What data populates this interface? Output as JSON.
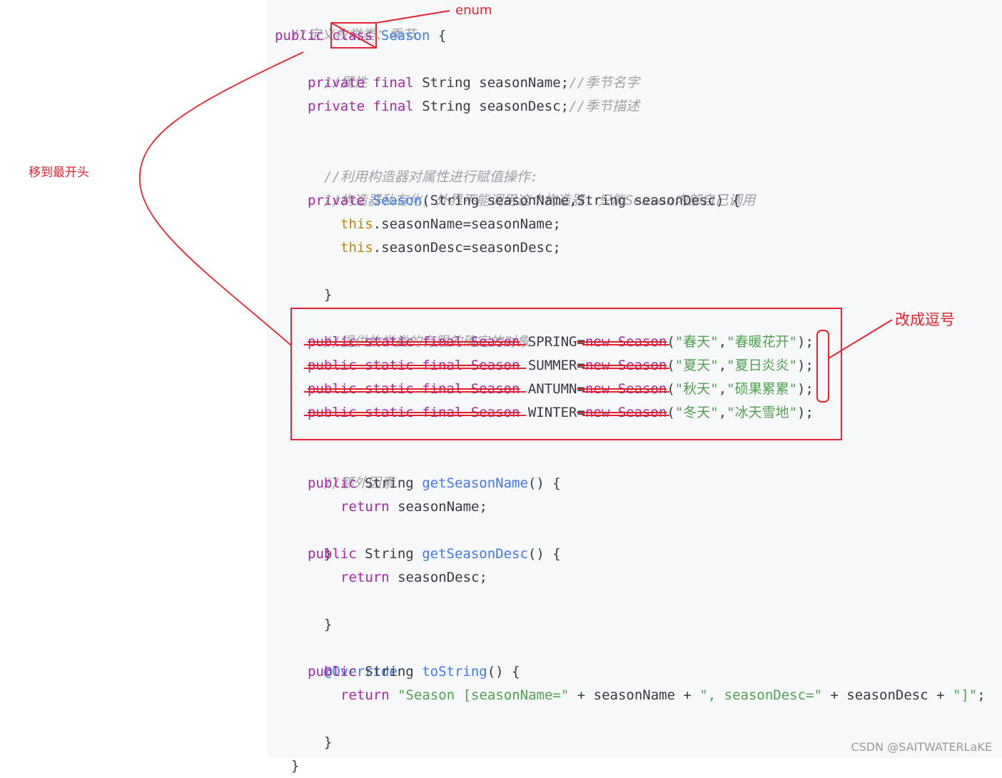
{
  "code": {
    "c1": "//定义枚举类：季节",
    "l2_public": "public",
    "l2_class": "class",
    "l2_season": "Season",
    "l2_brace": "{",
    "c3": "//属性",
    "l4_private": "private",
    "l4_final": "final",
    "l4_decl": "String seasonName;",
    "l4_comment": "//季节名字",
    "l5_private": "private",
    "l5_final": "final",
    "l5_decl": "String seasonDesc;",
    "l5_comment": "//季节描述",
    "c7": "//利用构造器对属性进行赋值操作:",
    "c8": "//构造器私有化，外界不能调用这个构造器，只能Season内部自己调用",
    "l9_private": "private",
    "l9_season": "Season",
    "l9_params": "(String seasonName,String seasonDesc) {",
    "l10_this": "this",
    "l10_rest": ".seasonName=seasonName;",
    "l11_this": "this",
    "l11_rest": ".seasonDesc=seasonDesc;",
    "l12": "}",
    "c14": "//提供枚举类的有限的确定的对象",
    "enum_rows": [
      {
        "prefix": "public static final Season",
        "name": " SPRING",
        "eq": "=",
        "new": "new Season",
        "open": "(",
        "a": "\"春天\"",
        "comma": ",",
        "b": "\"春暖花开\"",
        "end": ");"
      },
      {
        "prefix": "public static final Season",
        "name": " SUMMER",
        "eq": "=",
        "new": "new Season",
        "open": "(",
        "a": "\"夏天\"",
        "comma": ",",
        "b": "\"夏日炎炎\"",
        "end": ");"
      },
      {
        "prefix": "public static final Season",
        "name": " ANTUMN",
        "eq": "=",
        "new": "new Season",
        "open": "(",
        "a": "\"秋天\"",
        "comma": ",",
        "b": "\"硕果累累\"",
        "end": ");"
      },
      {
        "prefix": "public static final Season",
        "name": " WINTER",
        "eq": "=",
        "new": "new Season",
        "open": "(",
        "a": "\"冬天\"",
        "comma": ",",
        "b": "\"冰天雪地\"",
        "end": ");"
      }
    ],
    "c20": "//额外因素",
    "l21_public": "public",
    "l21_type": "String",
    "l21_fn": "getSeasonName",
    "l21_rest": "() {",
    "l22_return": "return",
    "l22_rest": "seasonName;",
    "l23": "}",
    "l24_public": "public",
    "l24_type": "String",
    "l24_fn": "getSeasonDesc",
    "l24_rest": "() {",
    "l25_return": "return",
    "l25_rest": "seasonDesc;",
    "l26": "}",
    "l28_ann": "@Override",
    "l29_public": "public",
    "l29_type": "String",
    "l29_fn": "toString",
    "l29_rest": "() {",
    "l30_return": "return",
    "l30_s1": "\"Season [seasonName=\"",
    "l30_p1": " + seasonName + ",
    "l30_s2": "\", seasonDesc=\"",
    "l30_p2": " + seasonDesc + ",
    "l30_s3": "\"]\"",
    "l30_end": ";",
    "l31": "}",
    "l32": "}"
  },
  "annotations": {
    "enum_label": "enum",
    "move_label": "移到最开头",
    "comma_label": "改成逗号",
    "color": "#e8232f"
  },
  "watermark": "CSDN @SAITWATERLaKE",
  "colors": {
    "keyword": "#a626a4",
    "function": "#4078f2",
    "this": "#c18401",
    "string": "#50a14f",
    "comment": "#a0a1a7",
    "plain": "#383a42",
    "code_bg": "#f6f8fa"
  }
}
